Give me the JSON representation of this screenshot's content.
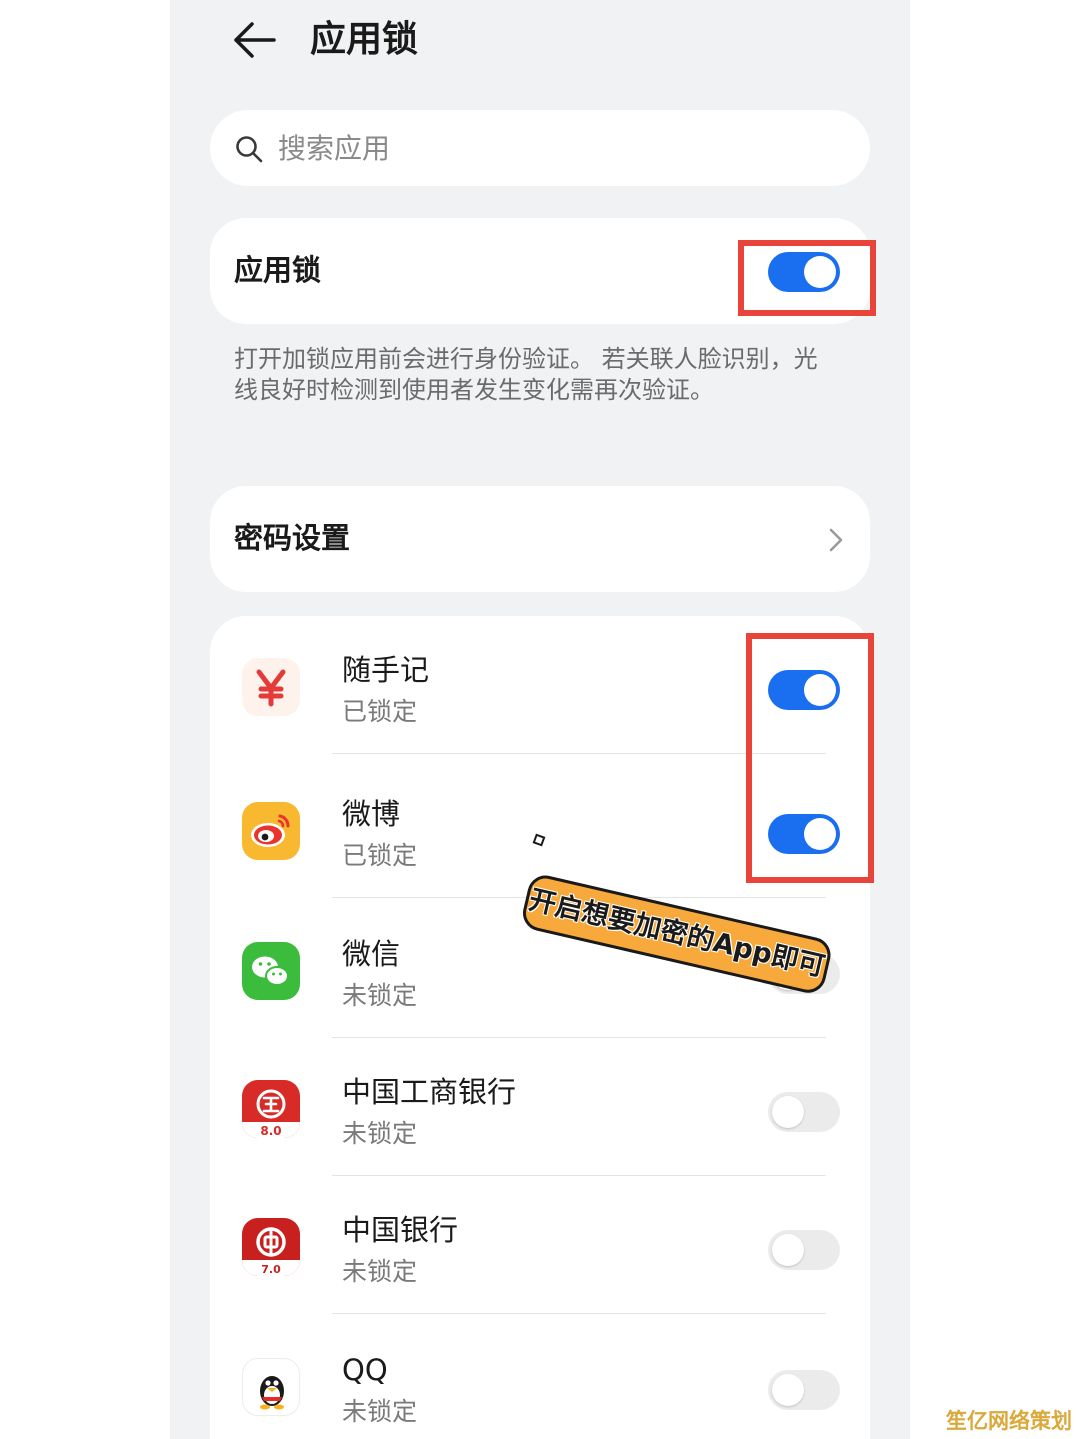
{
  "header": {
    "title": "应用锁"
  },
  "search": {
    "placeholder": "搜索应用"
  },
  "app_lock": {
    "label": "应用锁",
    "enabled": true,
    "description": "打开加锁应用前会进行身份验证。 若关联人脸识别，光线良好时检测到使用者发生变化需再次验证。"
  },
  "password_settings": {
    "label": "密码设置"
  },
  "apps": [
    {
      "name": "随手记",
      "status": "已锁定",
      "locked": true,
      "icon": "yen-icon"
    },
    {
      "name": "微博",
      "status": "已锁定",
      "locked": true,
      "icon": "weibo-icon"
    },
    {
      "name": "微信",
      "status": "未锁定",
      "locked": false,
      "icon": "wechat-icon"
    },
    {
      "name": "中国工商银行",
      "status": "未锁定",
      "locked": false,
      "icon": "icbc-icon",
      "icon_label": "8.0"
    },
    {
      "name": "中国银行",
      "status": "未锁定",
      "locked": false,
      "icon": "boc-icon",
      "icon_label": "7.0"
    },
    {
      "name": "QQ",
      "status": "未锁定",
      "locked": false,
      "icon": "qq-penguin-icon"
    }
  ],
  "annotation": {
    "text": "开启想要加密的App即可"
  },
  "watermark": {
    "text": "笙亿网络策划"
  },
  "colors": {
    "accent": "#1a6ef0",
    "highlight": "#e8443a",
    "sticker": "#f7a93b",
    "background": "#f1f2f4"
  }
}
